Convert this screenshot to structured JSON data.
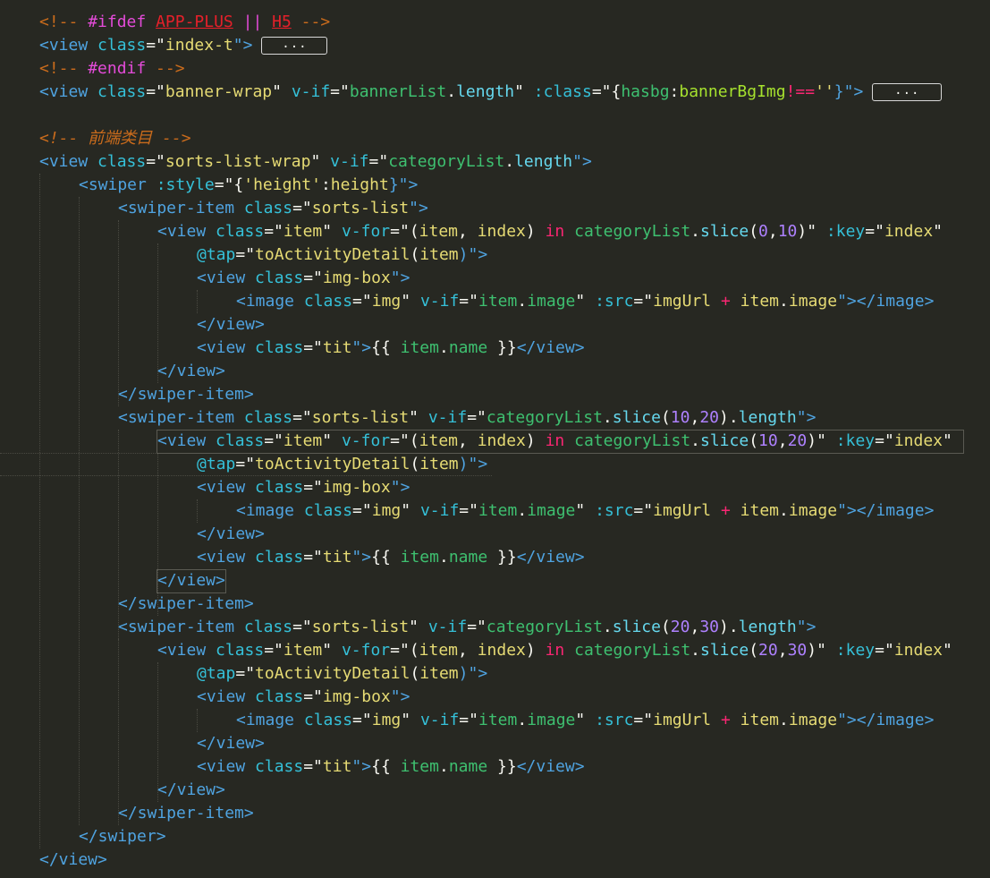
{
  "colors": {
    "background": "#272822",
    "comment": "#c96b1c",
    "directive": "#e44bd9",
    "error": "#e5202a",
    "tag": "#4fa3e0",
    "attr": "#35c0d8",
    "string": "#e6db74",
    "stringBody": "#3ec070",
    "text": "#f8f8f2",
    "keyword": "#f92672",
    "number": "#ae81ff",
    "prop": "#66d9ef",
    "attrValKey": "#a6e22e"
  },
  "fold_label": "...",
  "lines": [
    [
      {
        "t": "<!-- ",
        "c": "comment"
      },
      {
        "t": "#ifdef",
        "c": "directive"
      },
      {
        "t": " ",
        "c": "text"
      },
      {
        "t": "APP-PLUS",
        "c": "error",
        "u": true
      },
      {
        "t": " || ",
        "c": "directive"
      },
      {
        "t": "H5",
        "c": "error",
        "u": true
      },
      {
        "t": " -->",
        "c": "comment"
      }
    ],
    [
      {
        "t": "<view ",
        "c": "tag"
      },
      {
        "t": "class",
        "c": "attr"
      },
      {
        "t": "=\"",
        "c": "text"
      },
      {
        "t": "index-t",
        "c": "string"
      },
      {
        "t": "\">",
        "c": "tag"
      },
      {
        "fold": true
      }
    ],
    [
      {
        "t": "<!-- ",
        "c": "comment"
      },
      {
        "t": "#endif",
        "c": "directive"
      },
      {
        "t": " -->",
        "c": "comment"
      }
    ],
    [
      {
        "t": "<view ",
        "c": "tag"
      },
      {
        "t": "class",
        "c": "attr"
      },
      {
        "t": "=\"",
        "c": "text"
      },
      {
        "t": "banner-wrap",
        "c": "string"
      },
      {
        "t": "\" ",
        "c": "text"
      },
      {
        "t": "v-if",
        "c": "attr"
      },
      {
        "t": "=\"",
        "c": "text"
      },
      {
        "t": "bannerList",
        "c": "stringBody"
      },
      {
        "t": ".",
        "c": "text"
      },
      {
        "t": "length",
        "c": "prop"
      },
      {
        "t": "\" ",
        "c": "text"
      },
      {
        "t": ":class",
        "c": "attr"
      },
      {
        "t": "=\"{",
        "c": "text"
      },
      {
        "t": "hasbg",
        "c": "stringBody"
      },
      {
        "t": ":",
        "c": "text"
      },
      {
        "t": "bannerBgImg",
        "c": "attrValKey"
      },
      {
        "t": "!==",
        "c": "keyword"
      },
      {
        "t": "''",
        "c": "string"
      },
      {
        "t": "}\">",
        "c": "tag"
      },
      {
        "fold": true,
        "wide": true
      }
    ],
    [],
    [
      {
        "t": "<!-- 前端类目 -->",
        "c": "comment",
        "i": true
      }
    ],
    [
      {
        "t": "<view ",
        "c": "tag"
      },
      {
        "t": "class",
        "c": "attr"
      },
      {
        "t": "=\"",
        "c": "text"
      },
      {
        "t": "sorts-list-wrap",
        "c": "string"
      },
      {
        "t": "\" ",
        "c": "text"
      },
      {
        "t": "v-if",
        "c": "attr"
      },
      {
        "t": "=\"",
        "c": "text"
      },
      {
        "t": "categoryList",
        "c": "stringBody"
      },
      {
        "t": ".",
        "c": "text"
      },
      {
        "t": "length",
        "c": "prop"
      },
      {
        "t": "\">",
        "c": "tag"
      }
    ],
    [
      {
        "t": "<swiper ",
        "c": "tag"
      },
      {
        "t": ":style",
        "c": "attr"
      },
      {
        "t": "=\"{",
        "c": "text"
      },
      {
        "t": "'height'",
        "c": "string"
      },
      {
        "t": ":",
        "c": "text"
      },
      {
        "t": "height",
        "c": "string"
      },
      {
        "t": "}\">",
        "c": "tag"
      }
    ],
    [
      {
        "t": "<swiper-item ",
        "c": "tag"
      },
      {
        "t": "class",
        "c": "attr"
      },
      {
        "t": "=\"",
        "c": "text"
      },
      {
        "t": "sorts-list",
        "c": "string"
      },
      {
        "t": "\">",
        "c": "tag"
      }
    ],
    [
      {
        "t": "<view ",
        "c": "tag"
      },
      {
        "t": "class",
        "c": "attr"
      },
      {
        "t": "=\"",
        "c": "text"
      },
      {
        "t": "item",
        "c": "string"
      },
      {
        "t": "\" ",
        "c": "text"
      },
      {
        "t": "v-for",
        "c": "attr"
      },
      {
        "t": "=\"(",
        "c": "text"
      },
      {
        "t": "item",
        "c": "string"
      },
      {
        "t": ", ",
        "c": "text"
      },
      {
        "t": "index",
        "c": "string"
      },
      {
        "t": ") ",
        "c": "text"
      },
      {
        "t": "in",
        "c": "keyword"
      },
      {
        "t": " ",
        "c": "text"
      },
      {
        "t": "categoryList",
        "c": "stringBody"
      },
      {
        "t": ".",
        "c": "text"
      },
      {
        "t": "slice",
        "c": "prop"
      },
      {
        "t": "(",
        "c": "text"
      },
      {
        "t": "0",
        "c": "number"
      },
      {
        "t": ",",
        "c": "text"
      },
      {
        "t": "10",
        "c": "number"
      },
      {
        "t": ")\" ",
        "c": "text"
      },
      {
        "t": ":key",
        "c": "attr"
      },
      {
        "t": "=\"",
        "c": "text"
      },
      {
        "t": "index",
        "c": "string"
      },
      {
        "t": "\"",
        "c": "text"
      }
    ],
    [
      {
        "t": "@tap",
        "c": "attr"
      },
      {
        "t": "=\"",
        "c": "text"
      },
      {
        "t": "toActivityDetail",
        "c": "string"
      },
      {
        "t": "(",
        "c": "text"
      },
      {
        "t": "item",
        "c": "string"
      },
      {
        "t": ")\">",
        "c": "tag"
      }
    ],
    [
      {
        "t": "<view ",
        "c": "tag"
      },
      {
        "t": "class",
        "c": "attr"
      },
      {
        "t": "=\"",
        "c": "text"
      },
      {
        "t": "img-box",
        "c": "string"
      },
      {
        "t": "\">",
        "c": "tag"
      }
    ],
    [
      {
        "t": "<image ",
        "c": "tag"
      },
      {
        "t": "class",
        "c": "attr"
      },
      {
        "t": "=\"",
        "c": "text"
      },
      {
        "t": "img",
        "c": "string"
      },
      {
        "t": "\" ",
        "c": "text"
      },
      {
        "t": "v-if",
        "c": "attr"
      },
      {
        "t": "=\"",
        "c": "text"
      },
      {
        "t": "item",
        "c": "stringBody"
      },
      {
        "t": ".",
        "c": "text"
      },
      {
        "t": "image",
        "c": "stringBody"
      },
      {
        "t": "\" ",
        "c": "text"
      },
      {
        "t": ":src",
        "c": "attr"
      },
      {
        "t": "=\"",
        "c": "text"
      },
      {
        "t": "imgUrl",
        "c": "string"
      },
      {
        "t": " ",
        "c": "text"
      },
      {
        "t": "+",
        "c": "keyword"
      },
      {
        "t": " ",
        "c": "text"
      },
      {
        "t": "item",
        "c": "string"
      },
      {
        "t": ".",
        "c": "text"
      },
      {
        "t": "image",
        "c": "string"
      },
      {
        "t": "\">",
        "c": "tag"
      },
      {
        "t": "</image>",
        "c": "tag"
      }
    ],
    [
      {
        "t": "</view>",
        "c": "tag"
      }
    ],
    [
      {
        "t": "<view ",
        "c": "tag"
      },
      {
        "t": "class",
        "c": "attr"
      },
      {
        "t": "=\"",
        "c": "text"
      },
      {
        "t": "tit",
        "c": "string"
      },
      {
        "t": "\">",
        "c": "tag"
      },
      {
        "t": "{{ ",
        "c": "text"
      },
      {
        "t": "item",
        "c": "stringBody"
      },
      {
        "t": ".",
        "c": "text"
      },
      {
        "t": "name",
        "c": "stringBody"
      },
      {
        "t": " }}",
        "c": "text"
      },
      {
        "t": "</view>",
        "c": "tag"
      }
    ],
    [
      {
        "t": "</view>",
        "c": "tag"
      }
    ],
    [
      {
        "t": "</swiper-item>",
        "c": "tag"
      }
    ],
    [
      {
        "t": "<swiper-item ",
        "c": "tag"
      },
      {
        "t": "class",
        "c": "attr"
      },
      {
        "t": "=\"",
        "c": "text"
      },
      {
        "t": "sorts-list",
        "c": "string"
      },
      {
        "t": "\" ",
        "c": "text"
      },
      {
        "t": "v-if",
        "c": "attr"
      },
      {
        "t": "=\"",
        "c": "text"
      },
      {
        "t": "categoryList",
        "c": "stringBody"
      },
      {
        "t": ".",
        "c": "text"
      },
      {
        "t": "slice",
        "c": "prop"
      },
      {
        "t": "(",
        "c": "text"
      },
      {
        "t": "10",
        "c": "number"
      },
      {
        "t": ",",
        "c": "text"
      },
      {
        "t": "20",
        "c": "number"
      },
      {
        "t": ").",
        "c": "text"
      },
      {
        "t": "length",
        "c": "prop"
      },
      {
        "t": "\">",
        "c": "tag"
      }
    ],
    [
      {
        "t": "<view ",
        "c": "tag"
      },
      {
        "t": "class",
        "c": "attr"
      },
      {
        "t": "=\"",
        "c": "text"
      },
      {
        "t": "item",
        "c": "string"
      },
      {
        "t": "\" ",
        "c": "text"
      },
      {
        "t": "v-for",
        "c": "attr"
      },
      {
        "t": "=\"(",
        "c": "text"
      },
      {
        "t": "item",
        "c": "string"
      },
      {
        "t": ", ",
        "c": "text"
      },
      {
        "t": "index",
        "c": "string"
      },
      {
        "t": ") ",
        "c": "text"
      },
      {
        "t": "in",
        "c": "keyword"
      },
      {
        "t": " ",
        "c": "text"
      },
      {
        "t": "categoryList",
        "c": "stringBody"
      },
      {
        "t": ".",
        "c": "text"
      },
      {
        "t": "slice",
        "c": "prop"
      },
      {
        "t": "(",
        "c": "text"
      },
      {
        "t": "10",
        "c": "number"
      },
      {
        "t": ",",
        "c": "text"
      },
      {
        "t": "20",
        "c": "number"
      },
      {
        "t": ")\" ",
        "c": "text"
      },
      {
        "t": ":key",
        "c": "attr"
      },
      {
        "t": "=\"",
        "c": "text"
      },
      {
        "t": "index",
        "c": "string"
      },
      {
        "t": "\"",
        "c": "text"
      }
    ],
    [
      {
        "t": "@tap",
        "c": "attr"
      },
      {
        "t": "=\"",
        "c": "text"
      },
      {
        "t": "toActivityDetail",
        "c": "string"
      },
      {
        "t": "(",
        "c": "text"
      },
      {
        "t": "item",
        "c": "string"
      },
      {
        "t": ")\">",
        "c": "tag"
      }
    ],
    [
      {
        "t": "<view ",
        "c": "tag"
      },
      {
        "t": "class",
        "c": "attr"
      },
      {
        "t": "=\"",
        "c": "text"
      },
      {
        "t": "img-box",
        "c": "string"
      },
      {
        "t": "\">",
        "c": "tag"
      }
    ],
    [
      {
        "t": "<image ",
        "c": "tag"
      },
      {
        "t": "class",
        "c": "attr"
      },
      {
        "t": "=\"",
        "c": "text"
      },
      {
        "t": "img",
        "c": "string"
      },
      {
        "t": "\" ",
        "c": "text"
      },
      {
        "t": "v-if",
        "c": "attr"
      },
      {
        "t": "=\"",
        "c": "text"
      },
      {
        "t": "item",
        "c": "stringBody"
      },
      {
        "t": ".",
        "c": "text"
      },
      {
        "t": "image",
        "c": "stringBody"
      },
      {
        "t": "\" ",
        "c": "text"
      },
      {
        "t": ":src",
        "c": "attr"
      },
      {
        "t": "=\"",
        "c": "text"
      },
      {
        "t": "imgUrl",
        "c": "string"
      },
      {
        "t": " ",
        "c": "text"
      },
      {
        "t": "+",
        "c": "keyword"
      },
      {
        "t": " ",
        "c": "text"
      },
      {
        "t": "item",
        "c": "string"
      },
      {
        "t": ".",
        "c": "text"
      },
      {
        "t": "image",
        "c": "string"
      },
      {
        "t": "\">",
        "c": "tag"
      },
      {
        "t": "</image>",
        "c": "tag"
      }
    ],
    [
      {
        "t": "</view>",
        "c": "tag"
      }
    ],
    [
      {
        "t": "<view ",
        "c": "tag"
      },
      {
        "t": "class",
        "c": "attr"
      },
      {
        "t": "=\"",
        "c": "text"
      },
      {
        "t": "tit",
        "c": "string"
      },
      {
        "t": "\">",
        "c": "tag"
      },
      {
        "t": "{{ ",
        "c": "text"
      },
      {
        "t": "item",
        "c": "stringBody"
      },
      {
        "t": ".",
        "c": "text"
      },
      {
        "t": "name",
        "c": "stringBody"
      },
      {
        "t": " }}",
        "c": "text"
      },
      {
        "t": "</view>",
        "c": "tag"
      }
    ],
    [
      {
        "t": "</view>",
        "c": "tag"
      }
    ],
    [
      {
        "t": "</swiper-item>",
        "c": "tag"
      }
    ],
    [
      {
        "t": "<swiper-item ",
        "c": "tag"
      },
      {
        "t": "class",
        "c": "attr"
      },
      {
        "t": "=\"",
        "c": "text"
      },
      {
        "t": "sorts-list",
        "c": "string"
      },
      {
        "t": "\" ",
        "c": "text"
      },
      {
        "t": "v-if",
        "c": "attr"
      },
      {
        "t": "=\"",
        "c": "text"
      },
      {
        "t": "categoryList",
        "c": "stringBody"
      },
      {
        "t": ".",
        "c": "text"
      },
      {
        "t": "slice",
        "c": "prop"
      },
      {
        "t": "(",
        "c": "text"
      },
      {
        "t": "20",
        "c": "number"
      },
      {
        "t": ",",
        "c": "text"
      },
      {
        "t": "30",
        "c": "number"
      },
      {
        "t": ").",
        "c": "text"
      },
      {
        "t": "length",
        "c": "prop"
      },
      {
        "t": "\">",
        "c": "tag"
      }
    ],
    [
      {
        "t": "<view ",
        "c": "tag"
      },
      {
        "t": "class",
        "c": "attr"
      },
      {
        "t": "=\"",
        "c": "text"
      },
      {
        "t": "item",
        "c": "string"
      },
      {
        "t": "\" ",
        "c": "text"
      },
      {
        "t": "v-for",
        "c": "attr"
      },
      {
        "t": "=\"(",
        "c": "text"
      },
      {
        "t": "item",
        "c": "string"
      },
      {
        "t": ", ",
        "c": "text"
      },
      {
        "t": "index",
        "c": "string"
      },
      {
        "t": ") ",
        "c": "text"
      },
      {
        "t": "in",
        "c": "keyword"
      },
      {
        "t": " ",
        "c": "text"
      },
      {
        "t": "categoryList",
        "c": "stringBody"
      },
      {
        "t": ".",
        "c": "text"
      },
      {
        "t": "slice",
        "c": "prop"
      },
      {
        "t": "(",
        "c": "text"
      },
      {
        "t": "20",
        "c": "number"
      },
      {
        "t": ",",
        "c": "text"
      },
      {
        "t": "30",
        "c": "number"
      },
      {
        "t": ")\" ",
        "c": "text"
      },
      {
        "t": ":key",
        "c": "attr"
      },
      {
        "t": "=\"",
        "c": "text"
      },
      {
        "t": "index",
        "c": "string"
      },
      {
        "t": "\"",
        "c": "text"
      }
    ],
    [
      {
        "t": "@tap",
        "c": "attr"
      },
      {
        "t": "=\"",
        "c": "text"
      },
      {
        "t": "toActivityDetail",
        "c": "string"
      },
      {
        "t": "(",
        "c": "text"
      },
      {
        "t": "item",
        "c": "string"
      },
      {
        "t": ")\">",
        "c": "tag"
      }
    ],
    [
      {
        "t": "<view ",
        "c": "tag"
      },
      {
        "t": "class",
        "c": "attr"
      },
      {
        "t": "=\"",
        "c": "text"
      },
      {
        "t": "img-box",
        "c": "string"
      },
      {
        "t": "\">",
        "c": "tag"
      }
    ],
    [
      {
        "t": "<image ",
        "c": "tag"
      },
      {
        "t": "class",
        "c": "attr"
      },
      {
        "t": "=\"",
        "c": "text"
      },
      {
        "t": "img",
        "c": "string"
      },
      {
        "t": "\" ",
        "c": "text"
      },
      {
        "t": "v-if",
        "c": "attr"
      },
      {
        "t": "=\"",
        "c": "text"
      },
      {
        "t": "item",
        "c": "stringBody"
      },
      {
        "t": ".",
        "c": "text"
      },
      {
        "t": "image",
        "c": "stringBody"
      },
      {
        "t": "\" ",
        "c": "text"
      },
      {
        "t": ":src",
        "c": "attr"
      },
      {
        "t": "=\"",
        "c": "text"
      },
      {
        "t": "imgUrl",
        "c": "string"
      },
      {
        "t": " ",
        "c": "text"
      },
      {
        "t": "+",
        "c": "keyword"
      },
      {
        "t": " ",
        "c": "text"
      },
      {
        "t": "item",
        "c": "string"
      },
      {
        "t": ".",
        "c": "text"
      },
      {
        "t": "image",
        "c": "string"
      },
      {
        "t": "\">",
        "c": "tag"
      },
      {
        "t": "</image>",
        "c": "tag"
      }
    ],
    [
      {
        "t": "</view>",
        "c": "tag"
      }
    ],
    [
      {
        "t": "<view ",
        "c": "tag"
      },
      {
        "t": "class",
        "c": "attr"
      },
      {
        "t": "=\"",
        "c": "text"
      },
      {
        "t": "tit",
        "c": "string"
      },
      {
        "t": "\">",
        "c": "tag"
      },
      {
        "t": "{{ ",
        "c": "text"
      },
      {
        "t": "item",
        "c": "stringBody"
      },
      {
        "t": ".",
        "c": "text"
      },
      {
        "t": "name",
        "c": "stringBody"
      },
      {
        "t": " }}",
        "c": "text"
      },
      {
        "t": "</view>",
        "c": "tag"
      }
    ],
    [
      {
        "t": "</view>",
        "c": "tag"
      }
    ],
    [
      {
        "t": "</swiper-item>",
        "c": "tag"
      }
    ],
    [
      {
        "t": "</swiper>",
        "c": "tag"
      }
    ],
    [
      {
        "t": "</view>",
        "c": "tag"
      }
    ]
  ]
}
